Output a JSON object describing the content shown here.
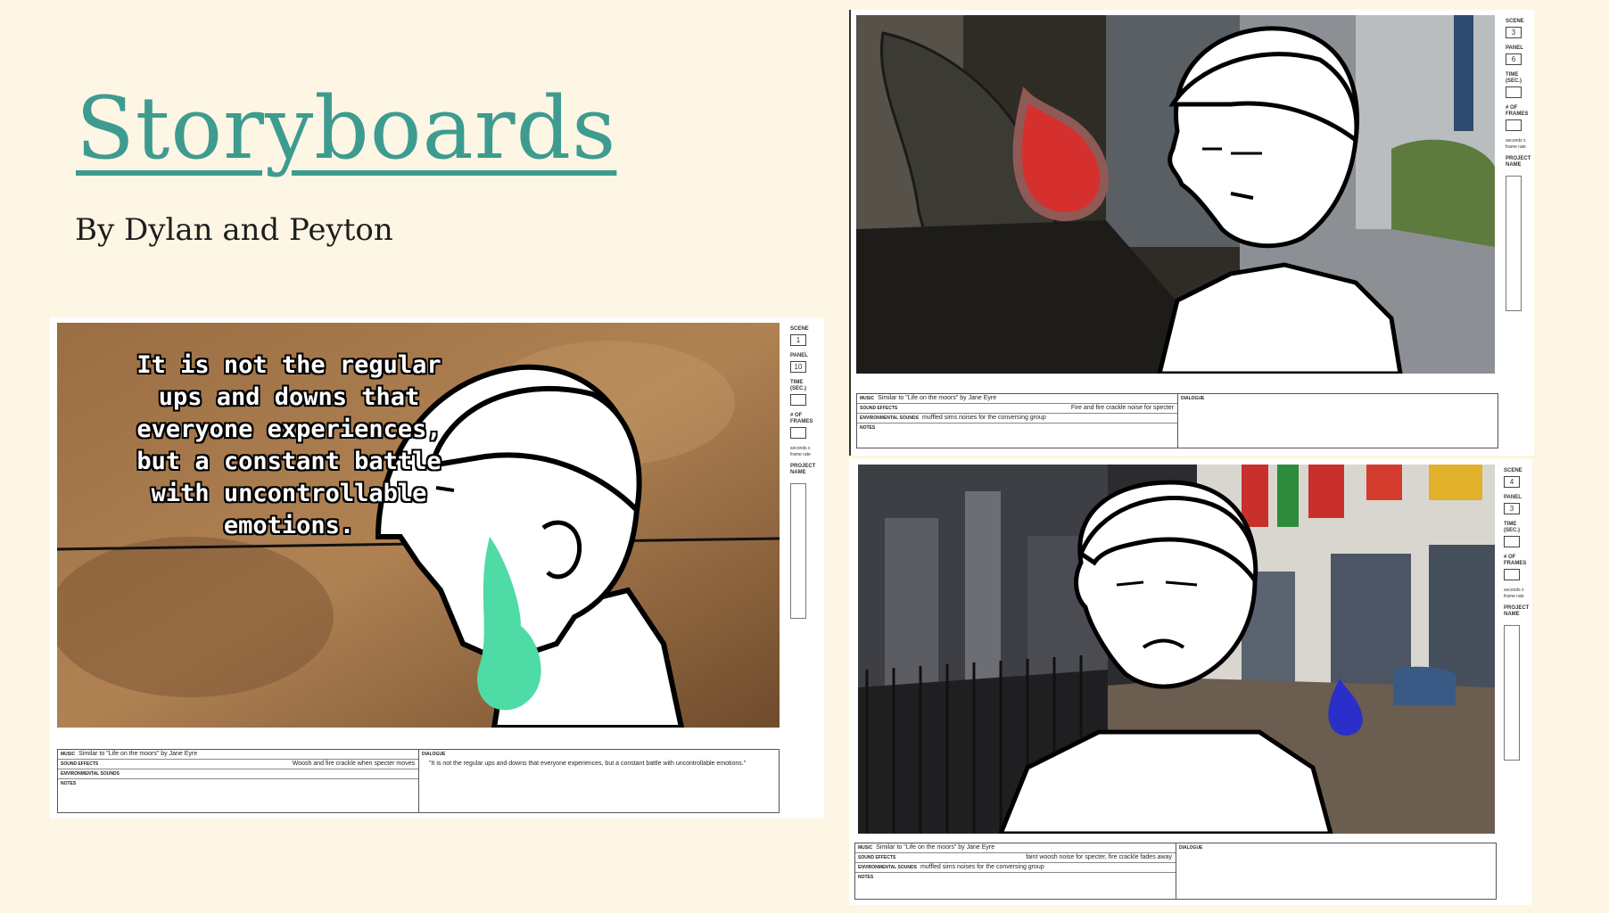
{
  "slide": {
    "title": "Storyboards",
    "byline": "By Dylan and Peyton"
  },
  "labels": {
    "scene": "SCENE",
    "panel": "PANEL",
    "time": "TIME (SEC.)",
    "frames": "# OF FRAMES",
    "frames_note": "seconds x frame rate",
    "project": "PROJECT NAME",
    "music": "MUSIC",
    "sound_effects": "SOUND EFFECTS",
    "environmental": "ENVIRONMENTAL SOUNDS",
    "notes": "NOTES",
    "dialogue": "DIALOGUE"
  },
  "boards": [
    {
      "scene": "1",
      "panel": "10",
      "caption": "It is not the regular ups and downs that everyone experiences, but a constant battle with uncontrollable emotions.",
      "music": "Similar to \"Life on the moors\" by Jane Eyre",
      "sound_effects": "Woosh and fire crackle when specter moves",
      "environmental": "",
      "dialogue": "\"It is not the regular ups and downs that everyone experiences, but a constant battle with uncontrollable emotions.\"",
      "flame_color": "#4fdba6"
    },
    {
      "scene": "3",
      "panel": "6",
      "music": "Similar to \"Life on the moors\" by Jane Eyre",
      "sound_effects": "Fire and fire crackle noise for specter",
      "environmental": "muffled sims noises for the conversing group",
      "dialogue": "",
      "flame_color": "#d6302e"
    },
    {
      "scene": "4",
      "panel": "3",
      "music": "Similar to \"Life on the moors\" by Jane Eyre",
      "sound_effects": "faint woosh noise for specter, fire crackle fades away",
      "environmental": "muffled sims noises for the conversing group",
      "dialogue": "",
      "flame_color": "#2a2fc9"
    }
  ]
}
